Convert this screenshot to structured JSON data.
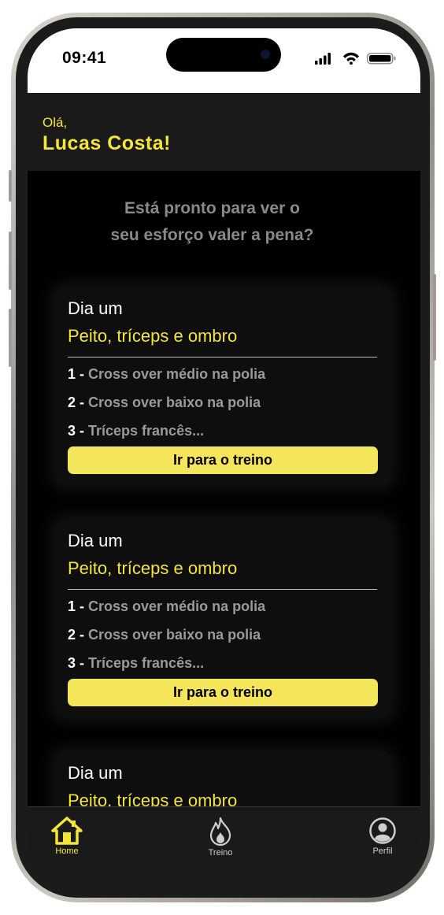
{
  "status_bar": {
    "time": "09:41"
  },
  "greeting": {
    "hello": "Olá,",
    "name": "Lucas Costa!"
  },
  "prompt": {
    "line1": "Está pronto para ver o",
    "line2": "seu esforço valer a pena?"
  },
  "cards": [
    {
      "day": "Dia um",
      "group": "Peito, tríceps e ombro",
      "exercises": [
        {
          "num": "1 - ",
          "name": "Cross over médio na polia"
        },
        {
          "num": "2 - ",
          "name": "Cross over baixo na polia"
        },
        {
          "num": "3 - ",
          "name": "Tríceps francês..."
        }
      ],
      "button": "Ir para o treino"
    },
    {
      "day": "Dia um",
      "group": "Peito, tríceps e ombro",
      "exercises": [
        {
          "num": "1 - ",
          "name": "Cross over médio na polia"
        },
        {
          "num": "2 - ",
          "name": "Cross over baixo na polia"
        },
        {
          "num": "3 - ",
          "name": "Tríceps francês..."
        }
      ],
      "button": "Ir para o treino"
    },
    {
      "day": "Dia um",
      "group": "Peito, tríceps e ombro",
      "exercises": [],
      "button": ""
    }
  ],
  "tabs": [
    {
      "label": "Home",
      "icon": "home-icon",
      "active": true
    },
    {
      "label": "Treino",
      "icon": "flame-icon",
      "active": false
    },
    {
      "label": "Perfil",
      "icon": "user-icon",
      "active": false
    }
  ],
  "colors": {
    "accent": "#f5e53a",
    "background": "#000000",
    "header": "#1a1a1a",
    "muted_text": "#8a8a8a"
  }
}
